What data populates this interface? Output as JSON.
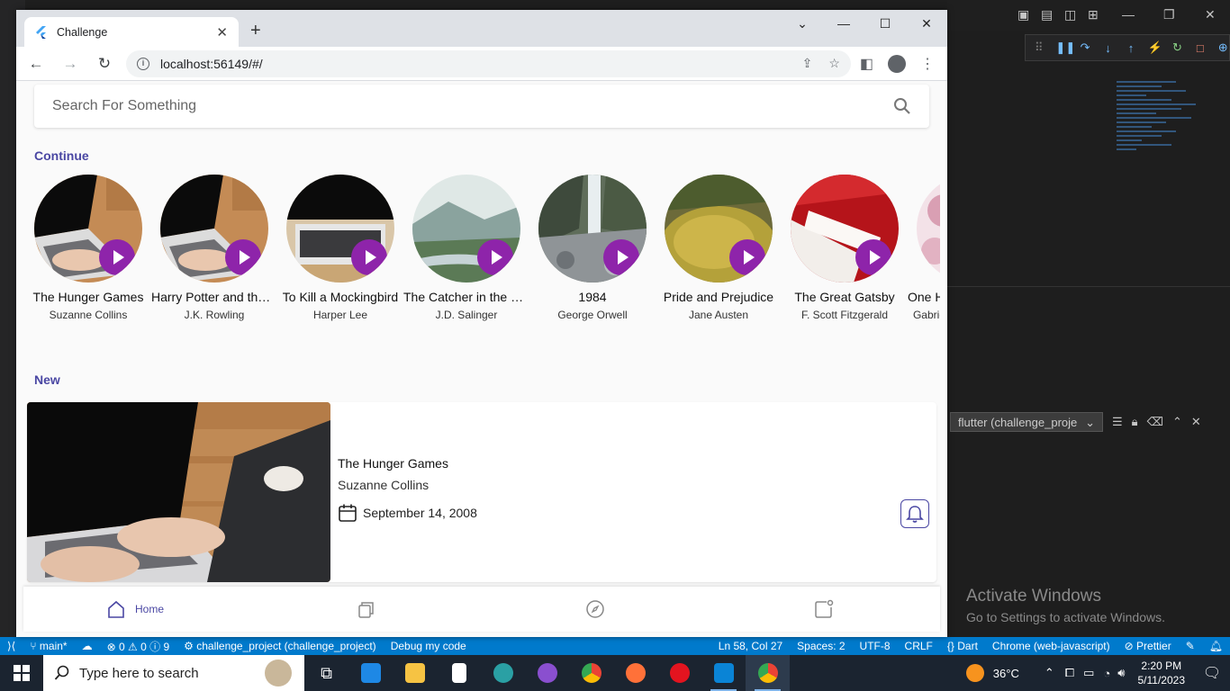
{
  "browser": {
    "tab_title": "Challenge",
    "url": "localhost:56149/#/"
  },
  "app": {
    "search_placeholder": "Search For Something",
    "continue_title": "Continue",
    "new_title": "New",
    "continue_books": [
      {
        "title": "The Hunger Games",
        "author": "Suzanne Collins",
        "art": "laptop"
      },
      {
        "title": "Harry Potter and the ...",
        "author": "J.K. Rowling",
        "art": "laptop"
      },
      {
        "title": "To Kill a Mockingbird",
        "author": "Harper Lee",
        "art": "keyboard"
      },
      {
        "title": "The Catcher in the Rye",
        "author": "J.D. Salinger",
        "art": "lake"
      },
      {
        "title": "1984",
        "author": "George Orwell",
        "art": "waterfall"
      },
      {
        "title": "Pride and Prejudice",
        "author": "Jane Austen",
        "art": "moss"
      },
      {
        "title": "The Great Gatsby",
        "author": "F. Scott Fitzgerald",
        "art": "red"
      },
      {
        "title": "One Hundred Years of Solitude",
        "author": "Gabriel García Márquez",
        "art": "pink"
      }
    ],
    "new_book": {
      "title": "The Hunger Games",
      "author": "Suzanne Collins",
      "date": "September 14, 2008"
    },
    "bottom_nav": {
      "home_label": "Home"
    },
    "accent_color": "#4a47a3",
    "play_color": "#8e24aa"
  },
  "vscode": {
    "terminal_select": "flutter (challenge_proje",
    "activate_title": "Activate Windows",
    "activate_sub": "Go to Settings to activate Windows.",
    "statusbar": {
      "branch": "main*",
      "problems": "⊗ 0 ⚠ 0 ⓘ 9",
      "project": "challenge_project (challenge_project)",
      "debug": "Debug my code",
      "position": "Ln 58, Col 27",
      "spaces": "Spaces: 2",
      "encoding": "UTF-8",
      "eol": "CRLF",
      "language": "{} Dart",
      "device": "Chrome (web-javascript)",
      "prettier": "⊘ Prettier"
    }
  },
  "taskbar": {
    "search_placeholder": "Type here to search",
    "weather": "36°C",
    "time": "2:20 PM",
    "date": "5/11/2023"
  }
}
